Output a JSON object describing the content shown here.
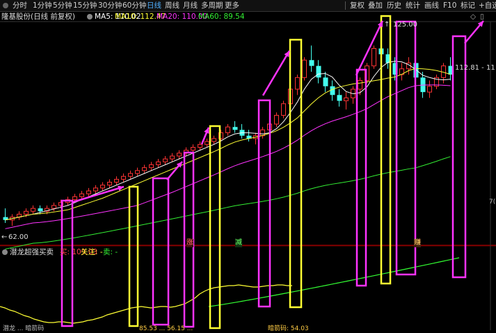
{
  "tabs": [
    "分时",
    "1分钟",
    "5分钟",
    "15分钟",
    "30分钟",
    "60分钟",
    "日线",
    "周线",
    "月线",
    "多周期",
    "更多"
  ],
  "active_tab": "日线",
  "right_tabs": [
    "复权",
    "叠加",
    "历史",
    "统计",
    "画线",
    "F10",
    "标记",
    "+自选"
  ],
  "stock_title": "隆基股份(日线 前复权)",
  "ma": {
    "ma5": {
      "label": "MA5: 110.02",
      "color": "#ffffff"
    },
    "ma10": {
      "label": "MA10: 112.47",
      "color": "#ffff33"
    },
    "ma20": {
      "label": "MA20: 110.00",
      "color": "#ff33ff"
    },
    "ma60": {
      "label": "MA60: 89.54",
      "color": "#33ee33"
    }
  },
  "price_labels": {
    "high": "125.00",
    "low": "62.00",
    "current": "112.81 - 11",
    "right_edge": "7("
  },
  "chart_markers": [
    "涨",
    "减",
    "赚"
  ],
  "indicator": {
    "name": "潜龙超强买卖",
    "buy_label": "买: 109.03",
    "focus_label": "关注: -",
    "sell_label": "卖: -"
  },
  "bottom_labels": {
    "left": "潜龙 ... 暗箭码",
    "mid": "85.53 ... 56.15 ...",
    "right": "暗箭码: 54.03"
  },
  "chart_data": {
    "type": "candlestick",
    "candles": [
      [
        63,
        66,
        61,
        62
      ],
      [
        62,
        64,
        60,
        63
      ],
      [
        63,
        65,
        62,
        64
      ],
      [
        64,
        66,
        63,
        65
      ],
      [
        65,
        67,
        64,
        66
      ],
      [
        66,
        67,
        64,
        65
      ],
      [
        65,
        67,
        64,
        66
      ],
      [
        66,
        68,
        65,
        67
      ],
      [
        67,
        69,
        66,
        68
      ],
      [
        68,
        70,
        67,
        69
      ],
      [
        69,
        71,
        68,
        70
      ],
      [
        70,
        72,
        69,
        71
      ],
      [
        71,
        73,
        70,
        72
      ],
      [
        72,
        74,
        71,
        73
      ],
      [
        73,
        75,
        72,
        74
      ],
      [
        74,
        76,
        73,
        75
      ],
      [
        75,
        77,
        74,
        76
      ],
      [
        76,
        78,
        75,
        77
      ],
      [
        77,
        79,
        76,
        78
      ],
      [
        78,
        80,
        77,
        79
      ],
      [
        79,
        81,
        78,
        80
      ],
      [
        80,
        82,
        79,
        81
      ],
      [
        81,
        83,
        80,
        82
      ],
      [
        82,
        84,
        81,
        83
      ],
      [
        83,
        85,
        82,
        84
      ],
      [
        84,
        86,
        83,
        85
      ],
      [
        85,
        87,
        84,
        86
      ],
      [
        86,
        88,
        85,
        87
      ],
      [
        87,
        89,
        86,
        88
      ],
      [
        88,
        90,
        87,
        89
      ],
      [
        89,
        91,
        88,
        90
      ],
      [
        90,
        93,
        89,
        92
      ],
      [
        92,
        95,
        91,
        94
      ],
      [
        94,
        96,
        92,
        93
      ],
      [
        93,
        95,
        90,
        91
      ],
      [
        91,
        93,
        89,
        90
      ],
      [
        90,
        92,
        88,
        91
      ],
      [
        91,
        94,
        90,
        93
      ],
      [
        93,
        96,
        92,
        95
      ],
      [
        95,
        99,
        94,
        98
      ],
      [
        98,
        103,
        97,
        102
      ],
      [
        102,
        108,
        101,
        107
      ],
      [
        107,
        112,
        105,
        111
      ],
      [
        111,
        118,
        110,
        117
      ],
      [
        117,
        122,
        113,
        115
      ],
      [
        115,
        117,
        109,
        111
      ],
      [
        111,
        113,
        106,
        108
      ],
      [
        108,
        110,
        103,
        105
      ],
      [
        105,
        107,
        101,
        103
      ],
      [
        103,
        106,
        100,
        104
      ],
      [
        104,
        108,
        102,
        107
      ],
      [
        107,
        111,
        105,
        110
      ],
      [
        110,
        116,
        109,
        115
      ],
      [
        115,
        122,
        114,
        121
      ],
      [
        121,
        125,
        118,
        119
      ],
      [
        119,
        121,
        114,
        116
      ],
      [
        116,
        118,
        110,
        112
      ],
      [
        112,
        116,
        110,
        114
      ],
      [
        114,
        118,
        112,
        116
      ],
      [
        116,
        118,
        110,
        111
      ],
      [
        111,
        113,
        104,
        106
      ],
      [
        106,
        110,
        104,
        108
      ],
      [
        108,
        112,
        107,
        111
      ],
      [
        111,
        116,
        109,
        115
      ],
      [
        115,
        118,
        110,
        112
      ]
    ],
    "ylim": [
      55,
      130
    ]
  }
}
